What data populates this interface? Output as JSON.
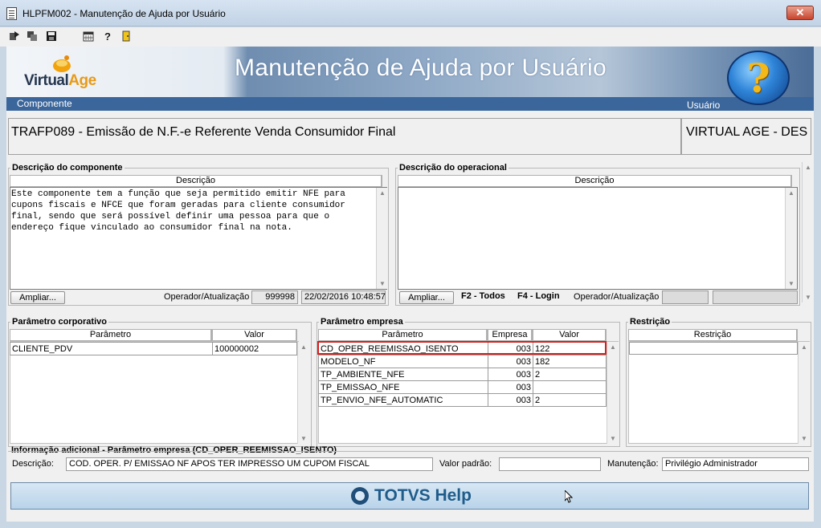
{
  "window": {
    "title": "HLPFM002 - Manutenção de Ajuda por Usuário",
    "close_glyph": "✕"
  },
  "toolbar": {
    "help_glyph": "?"
  },
  "banner": {
    "logo_virtual": "Virtual",
    "logo_age": "Age",
    "title": "Manutenção de Ajuda por Usuário",
    "component_label": "Componente",
    "user_label": "Usuário",
    "help_glyph": "?"
  },
  "component": {
    "name": "TRAFP089 - Emissão de N.F.-e Referente Venda Consumidor Final",
    "company": "VIRTUAL AGE - DES"
  },
  "desc_component": {
    "legend": "Descrição do componente",
    "column": "Descrição",
    "text": "Este componente tem a função que seja permitido emitir NFE para\ncupons fiscais e NFCE que foram geradas para cliente consumidor\nfinal, sendo que será possível definir uma pessoa para que o\nendereço fique vinculado ao consumidor final na nota.",
    "expand_button": "Ampliar...",
    "operator_label": "Operador/Atualização",
    "operator": "999998",
    "updated": "22/02/2016 10:48:57"
  },
  "desc_operational": {
    "legend": "Descrição do operacional",
    "column": "Descrição",
    "text": "",
    "expand_button": "Ampliar...",
    "hint_all": "F2 - Todos",
    "hint_login": "F4 - Login",
    "operator_label": "Operador/Atualização",
    "operator": "",
    "updated": ""
  },
  "corporate_params": {
    "legend": "Parâmetro corporativo",
    "columns": [
      "Parâmetro",
      "Valor"
    ],
    "rows": [
      {
        "param": "CLIENTE_PDV",
        "value": "100000002"
      }
    ]
  },
  "company_params": {
    "legend": "Parâmetro empresa",
    "columns": [
      "Parâmetro",
      "Empresa",
      "Valor"
    ],
    "rows": [
      {
        "param": "CD_OPER_REEMISSAO_ISENTO",
        "company": "003",
        "value": "122"
      },
      {
        "param": "MODELO_NF",
        "company": "003",
        "value": "182"
      },
      {
        "param": "TP_AMBIENTE_NFE",
        "company": "003",
        "value": "2"
      },
      {
        "param": "TP_EMISSAO_NFE",
        "company": "003",
        "value": ""
      },
      {
        "param": "TP_ENVIO_NFE_AUTOMATIC",
        "company": "003",
        "value": "2"
      }
    ]
  },
  "restriction": {
    "legend": "Restrição",
    "column": "Restrição"
  },
  "additional_info": {
    "legend": "Informação adicional - Parâmetro empresa (CD_OPER_REEMISSAO_ISENTO)",
    "description_label": "Descrição:",
    "description": "COD. OPER. P/ EMISSAO NF APOS TER IMPRESSO UM CUPOM FISCAL",
    "default_label": "Valor padrão:",
    "default_value": "",
    "maintenance_label": "Manutenção:",
    "maintenance": "Privilégio Administrador"
  },
  "help_bar": {
    "brand": "TOTVS Help"
  },
  "colors": {
    "banner_strip": "#3b669b",
    "highlight": "#d32020",
    "brand": "#1f5c8a"
  }
}
